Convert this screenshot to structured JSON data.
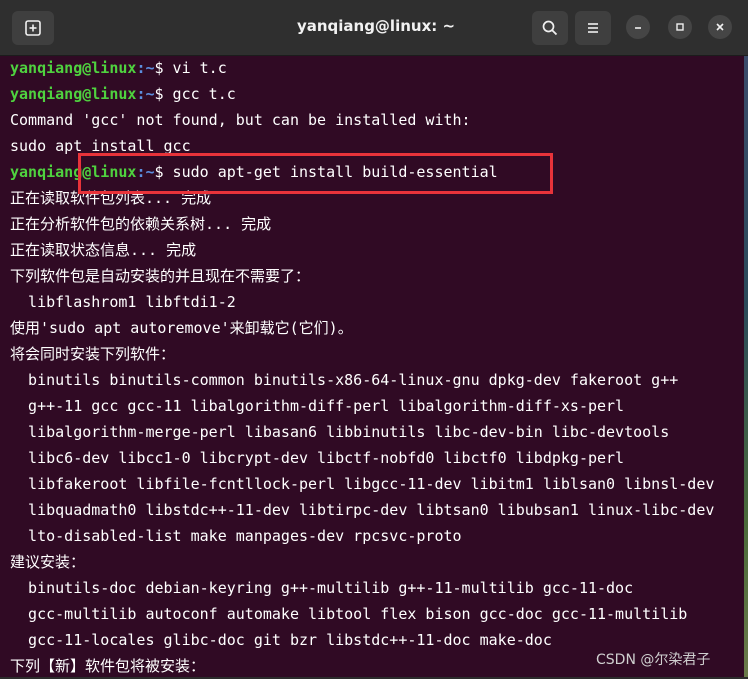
{
  "window": {
    "title": "yanqiang@linux: ~",
    "buttons": {
      "new_tab": "new-tab-icon",
      "search": "search-icon",
      "menu": "hamburger-menu-icon",
      "minimize": "minimize-icon",
      "maximize": "maximize-icon",
      "close": "close-icon"
    }
  },
  "prompt": {
    "user_host": "yanqiang@linux",
    "path": ":~",
    "symbol": "$"
  },
  "lines": [
    {
      "type": "cmd",
      "text": " vi t.c"
    },
    {
      "type": "cmd",
      "text": " gcc t.c"
    },
    {
      "type": "out",
      "text": "Command 'gcc' not found, but can be installed with:"
    },
    {
      "type": "out",
      "text": "sudo apt install gcc"
    },
    {
      "type": "cmd",
      "text": " sudo apt-get install build-essential"
    },
    {
      "type": "out",
      "text": "正在读取软件包列表... 完成"
    },
    {
      "type": "out",
      "text": "正在分析软件包的依赖关系树... 完成"
    },
    {
      "type": "out",
      "text": "正在读取状态信息... 完成"
    },
    {
      "type": "out",
      "text": "下列软件包是自动安装的并且现在不需要了："
    },
    {
      "type": "out",
      "text": "  libflashrom1 libftdi1-2"
    },
    {
      "type": "out",
      "text": "使用'sudo apt autoremove'来卸载它(它们)。"
    },
    {
      "type": "out",
      "text": "将会同时安装下列软件："
    },
    {
      "type": "out",
      "text": "  binutils binutils-common binutils-x86-64-linux-gnu dpkg-dev fakeroot g++"
    },
    {
      "type": "out",
      "text": "  g++-11 gcc gcc-11 libalgorithm-diff-perl libalgorithm-diff-xs-perl"
    },
    {
      "type": "out",
      "text": "  libalgorithm-merge-perl libasan6 libbinutils libc-dev-bin libc-devtools"
    },
    {
      "type": "out",
      "text": "  libc6-dev libcc1-0 libcrypt-dev libctf-nobfd0 libctf0 libdpkg-perl"
    },
    {
      "type": "out",
      "text": "  libfakeroot libfile-fcntllock-perl libgcc-11-dev libitm1 liblsan0 libnsl-dev"
    },
    {
      "type": "out",
      "text": "  libquadmath0 libstdc++-11-dev libtirpc-dev libtsan0 libubsan1 linux-libc-dev"
    },
    {
      "type": "out",
      "text": "  lto-disabled-list make manpages-dev rpcsvc-proto"
    },
    {
      "type": "out",
      "text": "建议安装："
    },
    {
      "type": "out",
      "text": "  binutils-doc debian-keyring g++-multilib g++-11-multilib gcc-11-doc"
    },
    {
      "type": "out",
      "text": "  gcc-multilib autoconf automake libtool flex bison gcc-doc gcc-11-multilib"
    },
    {
      "type": "out",
      "text": "  gcc-11-locales glibc-doc git bzr libstdc++-11-doc make-doc"
    },
    {
      "type": "out",
      "text": "下列【新】软件包将被安装："
    }
  ],
  "watermark": "CSDN @尔染君子",
  "colors": {
    "terminal_bg": "#300a24",
    "prompt_user": "#4fd23f",
    "prompt_path": "#5c8fe0",
    "highlight": "#e8333a"
  }
}
